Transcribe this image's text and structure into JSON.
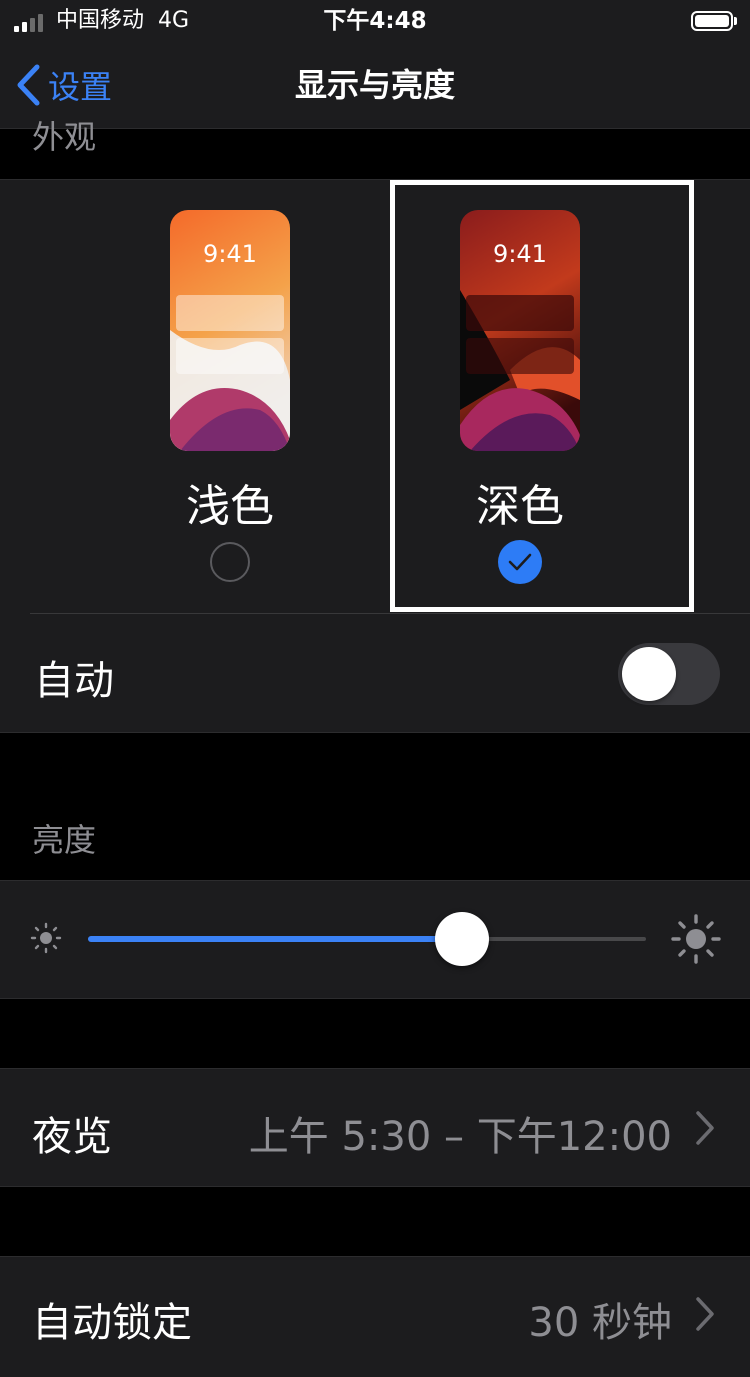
{
  "status_bar": {
    "carrier": "中国移动",
    "network": "4G",
    "time": "下午4:48"
  },
  "nav": {
    "back_label": "设置",
    "title": "显示与亮度"
  },
  "appearance": {
    "header": "外观",
    "preview_time": "9:41",
    "light": {
      "label": "浅色",
      "selected": false
    },
    "dark": {
      "label": "深色",
      "selected": true
    },
    "auto_label": "自动",
    "auto_on": false
  },
  "brightness": {
    "header": "亮度",
    "level": 0.67
  },
  "night_shift": {
    "label": "夜览",
    "value": "上午 5:30 – 下午12:00"
  },
  "auto_lock": {
    "label": "自动锁定",
    "value": "30 秒钟"
  },
  "colors": {
    "accent": "#3b82f6",
    "background": "#000000",
    "cell": "#1c1c1e"
  }
}
